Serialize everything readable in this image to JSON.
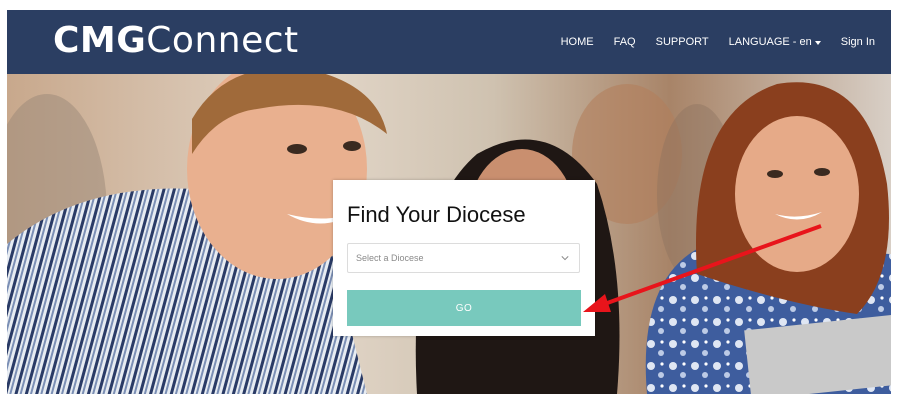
{
  "navbar": {
    "logo_bold": "CMG",
    "logo_light": "Connect",
    "links": {
      "home": "HOME",
      "faq": "FAQ",
      "support": "SUPPORT",
      "language": "LANGUAGE - en",
      "signin": "Sign In"
    },
    "background_color": "#2b3e62"
  },
  "hero": {
    "description_icons": [
      "photo-of-three-people-icon"
    ]
  },
  "diocese_card": {
    "title": "Find Your Diocese",
    "select_placeholder": "Select a Diocese",
    "go_label": "GO",
    "button_color": "#78c9bd"
  },
  "annotation": {
    "arrow_color": "#e8141b"
  }
}
